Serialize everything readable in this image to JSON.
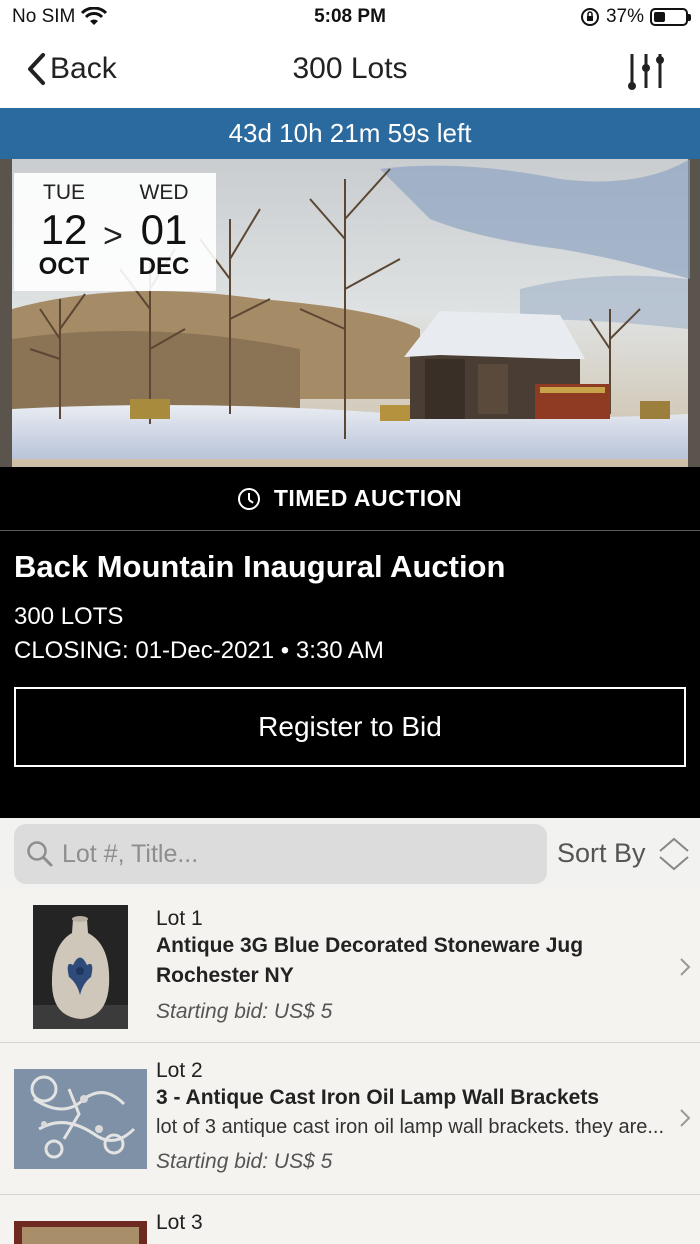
{
  "status_bar": {
    "carrier": "No SIM",
    "time": "5:08 PM",
    "battery": "37%"
  },
  "nav": {
    "back_label": "Back",
    "title": "300 Lots"
  },
  "countdown": "43d 10h 21m 59s left",
  "dates": {
    "start": {
      "dow": "TUE",
      "day": "12",
      "month": "OCT"
    },
    "separator": ">",
    "end": {
      "dow": "WED",
      "day": "01",
      "month": "DEC"
    }
  },
  "auction": {
    "type_label": "TIMED AUCTION",
    "title": "Back Mountain Inaugural Auction",
    "lots_count": "300 LOTS",
    "closing": "CLOSING: 01-Dec-2021 • 3:30 AM",
    "register_label": "Register to Bid"
  },
  "search": {
    "placeholder": "Lot #, Title...",
    "sort_label": "Sort By"
  },
  "lots": [
    {
      "lot_no": "Lot 1",
      "title_line1": "Antique 3G Blue Decorated Stoneware Jug",
      "title_line2": "Rochester NY",
      "description": "",
      "starting_bid": "Starting bid: US$ 5"
    },
    {
      "lot_no": "Lot 2",
      "title_line1": "3 - Antique Cast Iron Oil Lamp Wall Brackets",
      "title_line2": "",
      "description": "lot of 3 antique cast iron oil lamp wall brackets. they are...",
      "starting_bid": "Starting bid: US$ 5"
    },
    {
      "lot_no": "Lot 3",
      "title_line1": "",
      "title_line2": "",
      "description": "",
      "starting_bid": ""
    }
  ],
  "colors": {
    "countdown_bg": "#2b6a9e",
    "panel_bg": "#000000",
    "list_bg": "#f4f3ef"
  }
}
